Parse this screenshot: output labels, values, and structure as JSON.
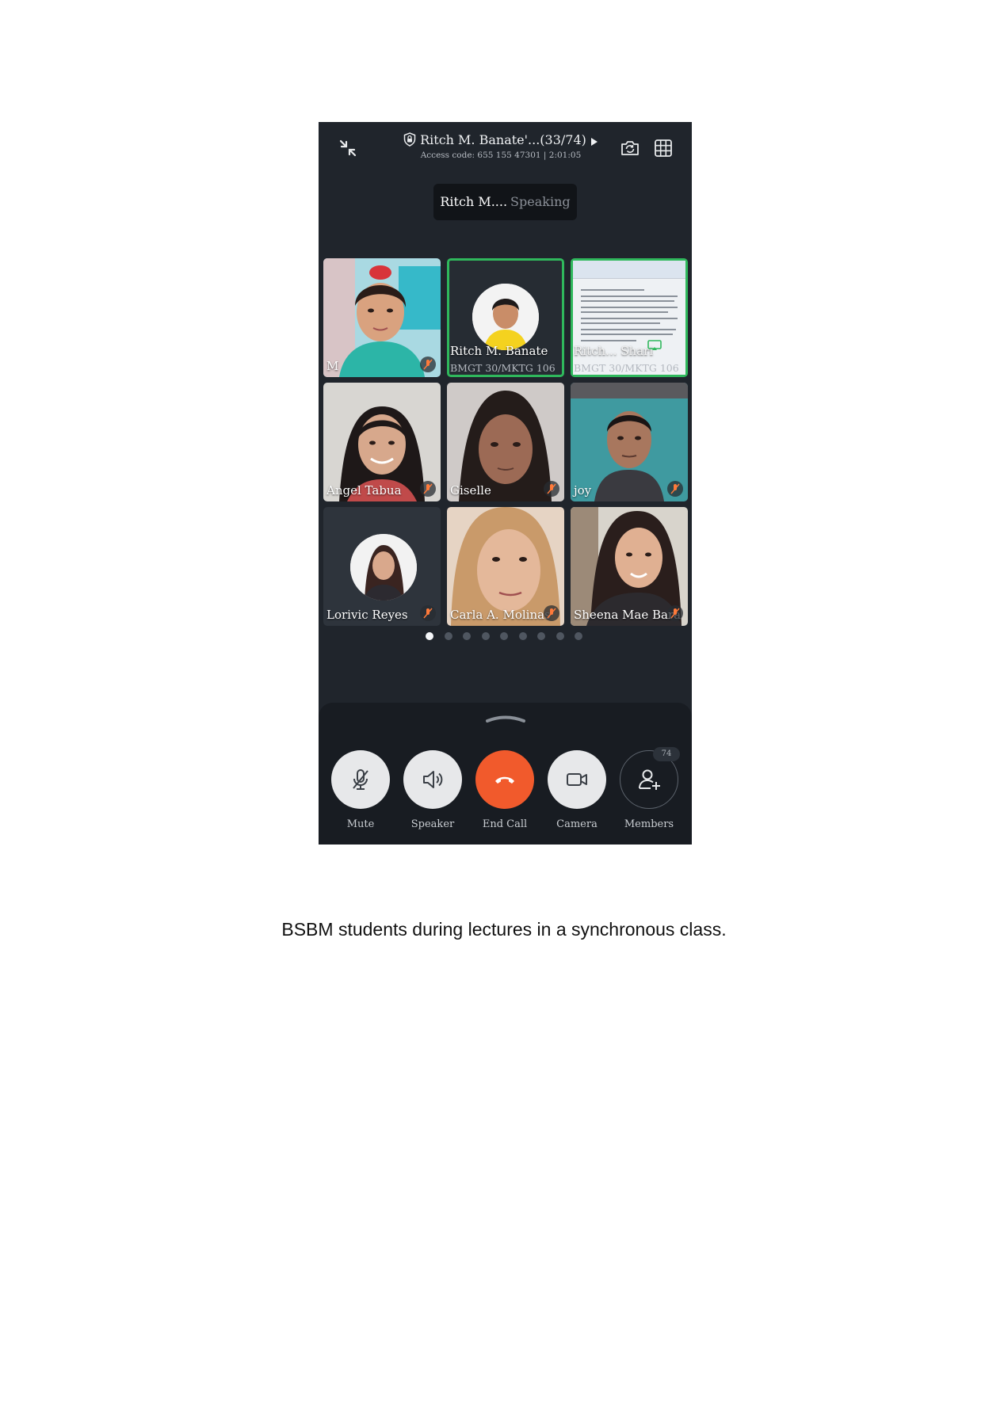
{
  "meeting": {
    "title": "Ritch M. Banate'...(33/74)",
    "access_line": "Access code: 655 155 47301 | 2:01:05"
  },
  "speaking": {
    "name": "Ritch M....",
    "state": "Speaking"
  },
  "tiles": [
    {
      "name": "M",
      "sub": ""
    },
    {
      "name": "Ritch M. Banate",
      "sub": "BMGT 30/MKTG 106"
    },
    {
      "name": "Ritch... Shari",
      "sub": "BMGT 30/MKTG 106"
    },
    {
      "name": "Angel Tabua",
      "sub": ""
    },
    {
      "name": "Giselle",
      "sub": ""
    },
    {
      "name": "joy",
      "sub": ""
    },
    {
      "name": "Lorivic Reyes",
      "sub": ""
    },
    {
      "name": "Carla A. Molinas",
      "sub": ""
    },
    {
      "name": "Sheena Mae Bara",
      "sub": ""
    }
  ],
  "pagination": {
    "pages": 9,
    "current": 1
  },
  "controls": {
    "mute": "Mute",
    "speaker": "Speaker",
    "end_call": "End Call",
    "camera": "Camera",
    "members": "Members",
    "members_count": "74"
  },
  "colors": {
    "background": "#20252c",
    "active_border": "#2fb85c",
    "end_call": "#f15a2c"
  },
  "caption": "BSBM students during lectures in a synchronous class."
}
